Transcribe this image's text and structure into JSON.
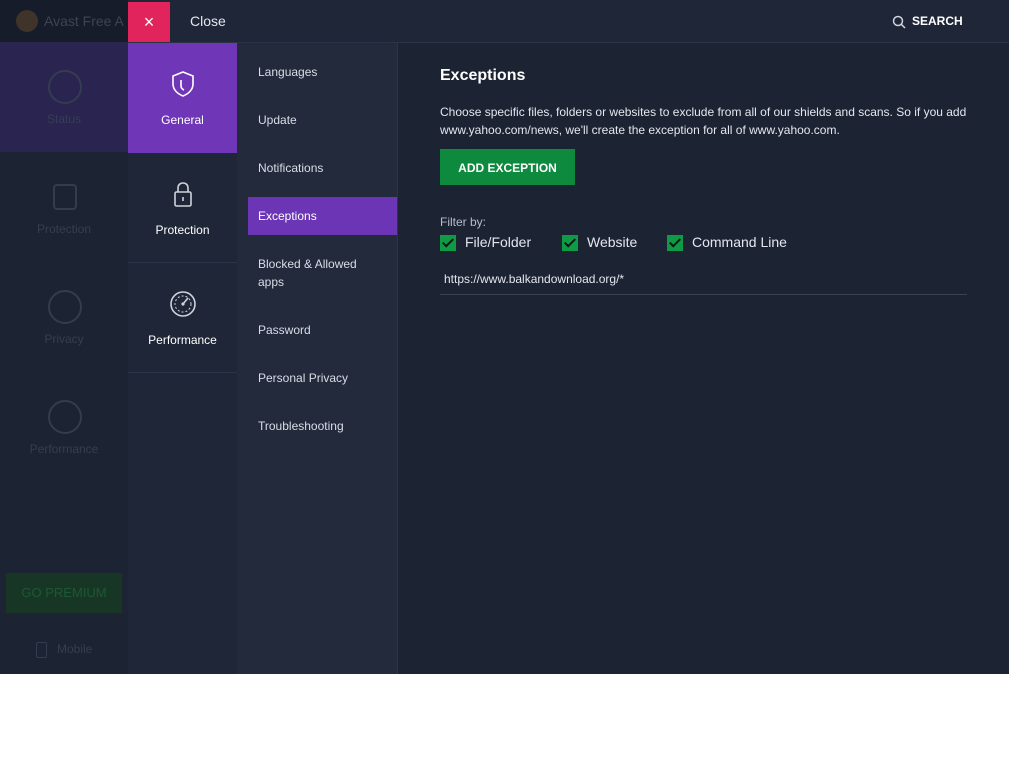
{
  "background_app": {
    "title": "Avast Free A",
    "nav": [
      "Status",
      "Protection",
      "Privacy",
      "Performance"
    ],
    "premium_button": "GO PREMIUM",
    "mobile": "Mobile"
  },
  "topbar": {
    "close_label": "Close",
    "close_icon": "×",
    "search_label": "SEARCH"
  },
  "categories": [
    {
      "label": "General",
      "icon": "shield-icon",
      "active": true
    },
    {
      "label": "Protection",
      "icon": "lock-icon",
      "active": false
    },
    {
      "label": "Performance",
      "icon": "speedometer-icon",
      "active": false
    }
  ],
  "subnav": [
    "Languages",
    "Update",
    "Notifications",
    "Exceptions",
    "Blocked & Allowed apps",
    "Password",
    "Personal Privacy",
    "Troubleshooting"
  ],
  "content": {
    "heading": "Exceptions",
    "description": "Choose specific files, folders or websites to exclude from all of our shields and scans. So if you add www.yahoo.com/news, we'll create the exception for all of www.yahoo.com.",
    "add_button": "ADD EXCEPTION",
    "filter_label": "Filter by:",
    "filters": [
      "File/Folder",
      "Website",
      "Command Line"
    ],
    "exceptions": [
      "https://www.balkandownload.org/*"
    ]
  },
  "colors": {
    "accent_purple": "#7036b8",
    "close_red": "#e1245c",
    "button_green": "#0e8a3e",
    "background": "#1c2333"
  }
}
